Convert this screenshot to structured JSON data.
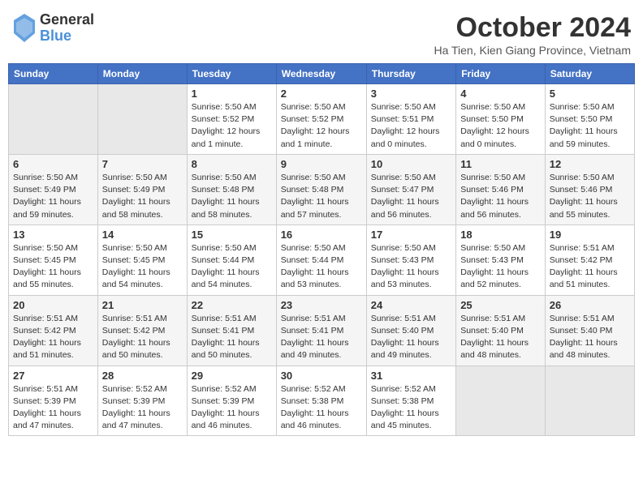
{
  "header": {
    "logo_general": "General",
    "logo_blue": "Blue",
    "title": "October 2024",
    "location": "Ha Tien, Kien Giang Province, Vietnam"
  },
  "weekdays": [
    "Sunday",
    "Monday",
    "Tuesday",
    "Wednesday",
    "Thursday",
    "Friday",
    "Saturday"
  ],
  "weeks": [
    [
      {
        "day": "",
        "info": ""
      },
      {
        "day": "",
        "info": ""
      },
      {
        "day": "1",
        "info": "Sunrise: 5:50 AM\nSunset: 5:52 PM\nDaylight: 12 hours\nand 1 minute."
      },
      {
        "day": "2",
        "info": "Sunrise: 5:50 AM\nSunset: 5:52 PM\nDaylight: 12 hours\nand 1 minute."
      },
      {
        "day": "3",
        "info": "Sunrise: 5:50 AM\nSunset: 5:51 PM\nDaylight: 12 hours\nand 0 minutes."
      },
      {
        "day": "4",
        "info": "Sunrise: 5:50 AM\nSunset: 5:50 PM\nDaylight: 12 hours\nand 0 minutes."
      },
      {
        "day": "5",
        "info": "Sunrise: 5:50 AM\nSunset: 5:50 PM\nDaylight: 11 hours\nand 59 minutes."
      }
    ],
    [
      {
        "day": "6",
        "info": "Sunrise: 5:50 AM\nSunset: 5:49 PM\nDaylight: 11 hours\nand 59 minutes."
      },
      {
        "day": "7",
        "info": "Sunrise: 5:50 AM\nSunset: 5:49 PM\nDaylight: 11 hours\nand 58 minutes."
      },
      {
        "day": "8",
        "info": "Sunrise: 5:50 AM\nSunset: 5:48 PM\nDaylight: 11 hours\nand 58 minutes."
      },
      {
        "day": "9",
        "info": "Sunrise: 5:50 AM\nSunset: 5:48 PM\nDaylight: 11 hours\nand 57 minutes."
      },
      {
        "day": "10",
        "info": "Sunrise: 5:50 AM\nSunset: 5:47 PM\nDaylight: 11 hours\nand 56 minutes."
      },
      {
        "day": "11",
        "info": "Sunrise: 5:50 AM\nSunset: 5:46 PM\nDaylight: 11 hours\nand 56 minutes."
      },
      {
        "day": "12",
        "info": "Sunrise: 5:50 AM\nSunset: 5:46 PM\nDaylight: 11 hours\nand 55 minutes."
      }
    ],
    [
      {
        "day": "13",
        "info": "Sunrise: 5:50 AM\nSunset: 5:45 PM\nDaylight: 11 hours\nand 55 minutes."
      },
      {
        "day": "14",
        "info": "Sunrise: 5:50 AM\nSunset: 5:45 PM\nDaylight: 11 hours\nand 54 minutes."
      },
      {
        "day": "15",
        "info": "Sunrise: 5:50 AM\nSunset: 5:44 PM\nDaylight: 11 hours\nand 54 minutes."
      },
      {
        "day": "16",
        "info": "Sunrise: 5:50 AM\nSunset: 5:44 PM\nDaylight: 11 hours\nand 53 minutes."
      },
      {
        "day": "17",
        "info": "Sunrise: 5:50 AM\nSunset: 5:43 PM\nDaylight: 11 hours\nand 53 minutes."
      },
      {
        "day": "18",
        "info": "Sunrise: 5:50 AM\nSunset: 5:43 PM\nDaylight: 11 hours\nand 52 minutes."
      },
      {
        "day": "19",
        "info": "Sunrise: 5:51 AM\nSunset: 5:42 PM\nDaylight: 11 hours\nand 51 minutes."
      }
    ],
    [
      {
        "day": "20",
        "info": "Sunrise: 5:51 AM\nSunset: 5:42 PM\nDaylight: 11 hours\nand 51 minutes."
      },
      {
        "day": "21",
        "info": "Sunrise: 5:51 AM\nSunset: 5:42 PM\nDaylight: 11 hours\nand 50 minutes."
      },
      {
        "day": "22",
        "info": "Sunrise: 5:51 AM\nSunset: 5:41 PM\nDaylight: 11 hours\nand 50 minutes."
      },
      {
        "day": "23",
        "info": "Sunrise: 5:51 AM\nSunset: 5:41 PM\nDaylight: 11 hours\nand 49 minutes."
      },
      {
        "day": "24",
        "info": "Sunrise: 5:51 AM\nSunset: 5:40 PM\nDaylight: 11 hours\nand 49 minutes."
      },
      {
        "day": "25",
        "info": "Sunrise: 5:51 AM\nSunset: 5:40 PM\nDaylight: 11 hours\nand 48 minutes."
      },
      {
        "day": "26",
        "info": "Sunrise: 5:51 AM\nSunset: 5:40 PM\nDaylight: 11 hours\nand 48 minutes."
      }
    ],
    [
      {
        "day": "27",
        "info": "Sunrise: 5:51 AM\nSunset: 5:39 PM\nDaylight: 11 hours\nand 47 minutes."
      },
      {
        "day": "28",
        "info": "Sunrise: 5:52 AM\nSunset: 5:39 PM\nDaylight: 11 hours\nand 47 minutes."
      },
      {
        "day": "29",
        "info": "Sunrise: 5:52 AM\nSunset: 5:39 PM\nDaylight: 11 hours\nand 46 minutes."
      },
      {
        "day": "30",
        "info": "Sunrise: 5:52 AM\nSunset: 5:38 PM\nDaylight: 11 hours\nand 46 minutes."
      },
      {
        "day": "31",
        "info": "Sunrise: 5:52 AM\nSunset: 5:38 PM\nDaylight: 11 hours\nand 45 minutes."
      },
      {
        "day": "",
        "info": ""
      },
      {
        "day": "",
        "info": ""
      }
    ]
  ]
}
